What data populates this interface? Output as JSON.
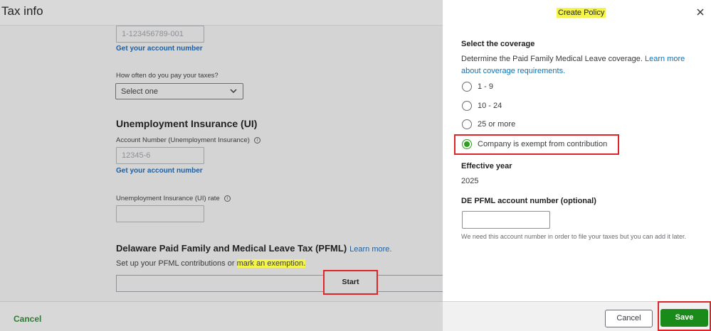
{
  "page": {
    "title": "Tax info"
  },
  "left": {
    "account_field": {
      "placeholder": "1-123456789-001"
    },
    "get_account_link": "Get your account number",
    "frequency_label": "How often do you pay your taxes?",
    "frequency_select": {
      "value": "Select one"
    },
    "ui_section": {
      "title": "Unemployment Insurance (UI)",
      "account_label": "Account Number (Unemployment Insurance)",
      "account_placeholder": "12345-6",
      "get_account_link": "Get your account number",
      "rate_label": "Unemployment Insurance (UI) rate"
    },
    "pfml": {
      "title": "Delaware Paid Family and Medical Leave Tax (PFML)",
      "learn_more": "Learn more.",
      "desc_prefix": "Set up your PFML contributions or ",
      "desc_highlight": "mark an exemption.",
      "start_label": "Start"
    },
    "footer": {
      "cancel_label": "Cancel"
    }
  },
  "panel": {
    "title": "Create Policy",
    "coverage": {
      "heading": "Select the coverage",
      "desc": "Determine the Paid Family Medical Leave coverage. ",
      "desc_link": "Learn more about coverage requirements.",
      "options": [
        {
          "label": "1 - 9",
          "checked": false
        },
        {
          "label": "10 - 24",
          "checked": false
        },
        {
          "label": "25 or more",
          "checked": false
        },
        {
          "label": "Company is exempt from contribution",
          "checked": true
        }
      ]
    },
    "effective_year": {
      "heading": "Effective year",
      "value": "2025"
    },
    "account": {
      "heading": "DE PFML account number (optional)",
      "note": "We need this account number in order to file your taxes but you can add it later."
    },
    "footer": {
      "cancel_label": "Cancel",
      "save_label": "Save"
    }
  },
  "colors": {
    "accent_green": "#2ca01c",
    "save_green": "#1a8a1a",
    "link_blue": "#0b75b8",
    "highlight": "#f4f44a",
    "annotation_red": "#e0242a"
  }
}
